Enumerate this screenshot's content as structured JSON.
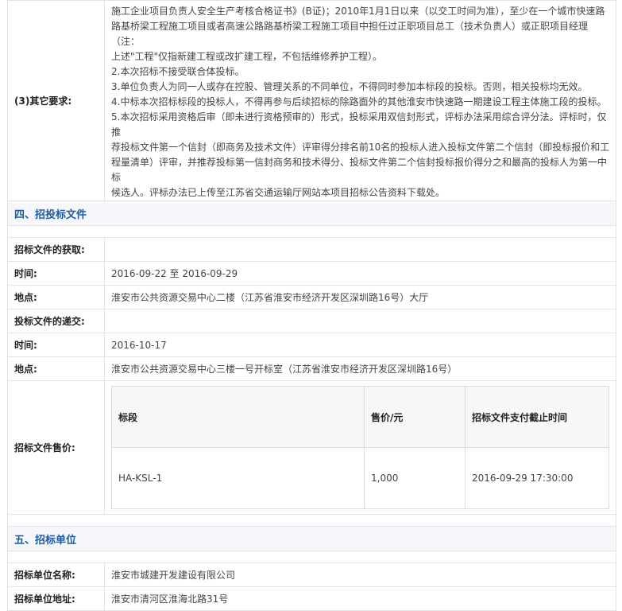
{
  "requirements": {
    "label": "(3)其它要求:",
    "lines": [
      "施工企业项目负责人安全生产考核合格证书》(B证)；2010年1月1日以来（以交工时间为准），至少在一个城市快速路",
      "路基桥梁工程施工项目或者高速公路路基桥梁工程施工项目中担任过正职项目总工（技术负责人）或正职项目经理（注：",
      "上述\"工程\"仅指新建工程或改扩建工程，不包括维修养护工程）。",
      "2.本次招标不接受联合体投标。",
      "3.单位负责人为同一人或存在控股、管理关系的不同单位，不得同时参加本标段的投标。否则，相关投标均无效。",
      "4.中标本次招标标段的投标人，不得再参与后续招标的除路面外的其他淮安市快速路一期建设工程主体施工段的投标。",
      "5.本次招标采用资格后审（即未进行资格预审的）形式，投标采用双信封形式，评标办法采用综合评分法。评标时，仅推",
      "荐投标文件第一个信封（即商务及技术文件）评审得分排名前10名的投标人进入投标文件第二个信封（即投标报价和工",
      "程量清单）评审，并推荐投标第一信封商务和技术得分、投标文件第二个信封投标报价得分之和最高的投标人为第一中标",
      "候选人。评标办法已上传至江苏省交通运输厅网站本项目招标公告资料下载处。"
    ]
  },
  "section4": {
    "title": "四、招投标文件",
    "obtain_label": "招标文件的获取:",
    "obtain_time_label": "时间:",
    "obtain_time_value": "2016-09-22 至 2016-09-29",
    "obtain_place_label": "地点:",
    "obtain_place_value": "淮安市公共资源交易中心二楼（江苏省淮安市经济开发区深圳路16号）大厅",
    "submit_label": "投标文件的递交:",
    "submit_time_label": "时间:",
    "submit_time_value": "2016-10-17",
    "submit_place_label": "地点:",
    "submit_place_value": "淮安市公共资源交易中心三楼一号开标室（江苏省淮安市经济开发区深圳路16号）",
    "price_label": "招标文件售价:",
    "price_table": {
      "headers": [
        "标段",
        "售价/元",
        "招标文件支付截止时间"
      ],
      "rows": [
        [
          "HA-KSL-1",
          "1,000",
          "2016-09-29 17:30:00"
        ]
      ]
    }
  },
  "section5": {
    "title": "五、招标单位",
    "name_label": "招标单位名称:",
    "name_value": "淮安市城建开发建设有限公司",
    "address_label": "招标单位地址:",
    "address_value": "淮安市清河区淮海北路31号"
  }
}
